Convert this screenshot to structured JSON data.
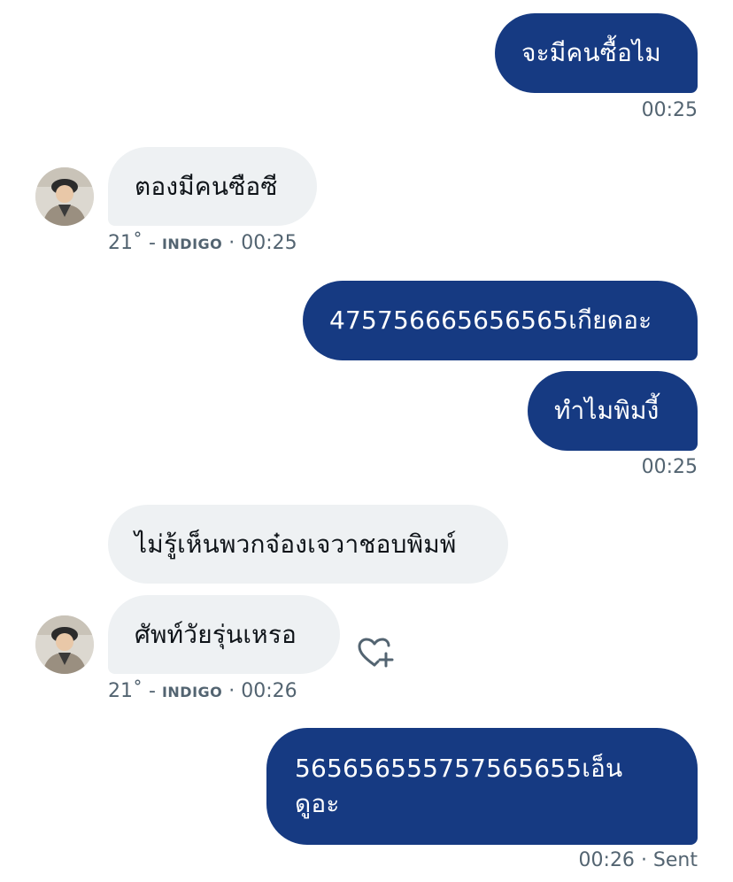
{
  "messages": [
    {
      "text": "จะมีคนซื้อไม",
      "meta": "00:25"
    },
    {
      "text": "ตองมีคนซือซี",
      "meta_degree": "21˚ -",
      "meta_brand": "INDIGO",
      "meta_time": "· 00:25"
    },
    {
      "text": "475756665656565เกียดอะ"
    },
    {
      "text": "ทำไมพิมงี้",
      "meta": "00:25"
    },
    {
      "text": "ไม่รู้เห็นพวกจ๋องเจวาชอบพิมพ์"
    },
    {
      "text": "ศัพท์วัยรุ่นเหรอ",
      "meta_degree": "21˚ -",
      "meta_brand": "INDIGO",
      "meta_time": "· 00:26"
    },
    {
      "text_line1": "565656555757565655เอ็น",
      "text_line2": "ดูอะ",
      "meta_time": "00:26",
      "meta_status": "· Sent"
    }
  ],
  "icons": {
    "avatar": "user-avatar",
    "reaction": "heart-plus-icon"
  },
  "colors": {
    "outgoing_bubble": "#163a82",
    "incoming_bubble": "#eef1f3",
    "meta_text": "#536471"
  }
}
